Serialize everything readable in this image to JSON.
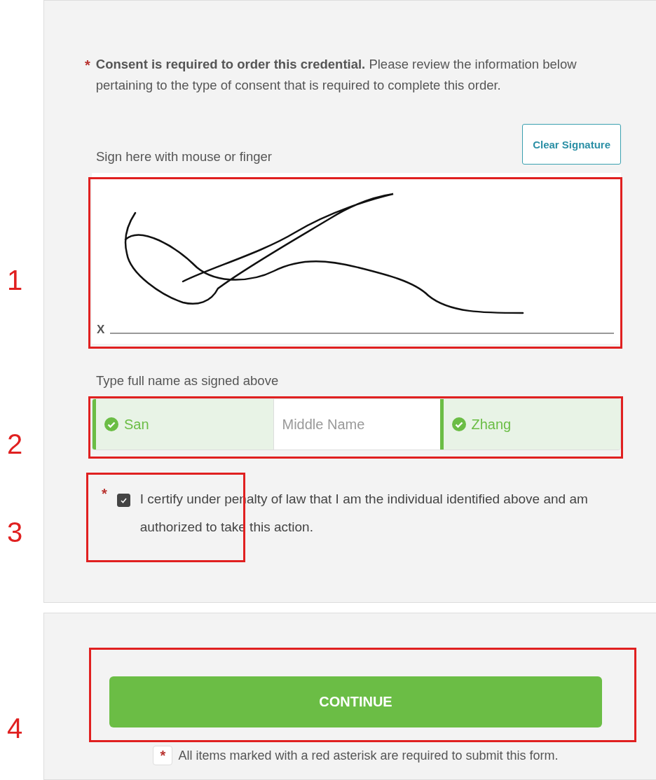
{
  "consent": {
    "required_mark": "*",
    "text": "**Consent is required to order this credential.** Please review the information below pertaining to the type of consent that is required to complete this order."
  },
  "signature": {
    "label": "Sign here with mouse or finger",
    "clear_button": "Clear Signature",
    "baseline_mark": "X",
    "signed": true
  },
  "name": {
    "label": "Type full name as signed above",
    "fields": [
      {
        "value": "San",
        "valid": true
      },
      {
        "placeholder": "Middle Name",
        "valid": false
      },
      {
        "value": "Zhang",
        "valid": true
      }
    ]
  },
  "certify": {
    "required_mark": "*",
    "checked": true,
    "text": "I certify under penalty of law that I am the individual identified above and am authorized to take this action."
  },
  "continue_button": "CONTINUE",
  "footnote": {
    "mark": "*",
    "text": "All items marked with a red asterisk are required to submit this form."
  },
  "annotations": [
    {
      "label": "1"
    },
    {
      "label": "2"
    },
    {
      "label": "3"
    },
    {
      "label": "4"
    }
  ]
}
